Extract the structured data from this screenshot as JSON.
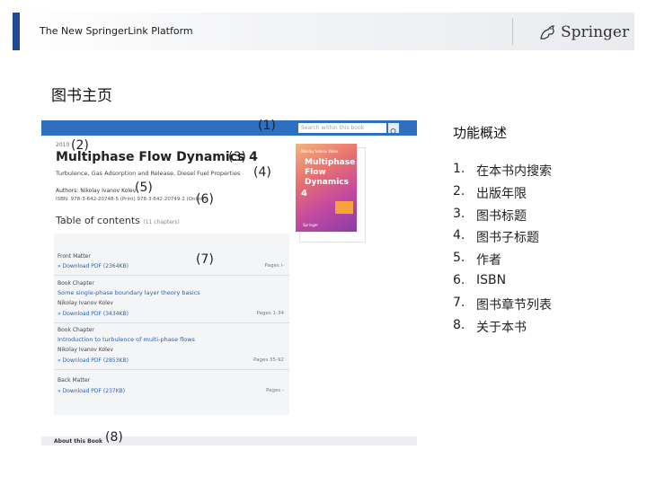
{
  "header": {
    "platform_title": "The New SpringerLink Platform",
    "logo_text": "Springer"
  },
  "page_heading": "图书主页",
  "screenshot": {
    "search_placeholder": "Search within this book",
    "year": "2010",
    "book_title": "Multiphase Flow Dynamics 4",
    "book_subtitle": "Turbulence, Gas Adsorption and Release, Diesel Fuel Properties",
    "authors": "Authors: Nikolay Ivanov Kolev",
    "isbn": "ISBN: 978-3-642-20748-5 (Print) 978-3-642-20749-2 (Online)",
    "toc_heading": "Table of contents",
    "toc_count": "(11 chapters)",
    "sections": [
      {
        "label": "Front Matter",
        "link": "» Download PDF (2364KB)",
        "pages": "Pages i-"
      },
      {
        "label": "Book Chapter",
        "title": "Some single-phase boundary layer theory basics",
        "author": "Nikolay Ivanov Kolev",
        "link": "» Download PDF (3434KB)",
        "pages": "Pages 1-34"
      },
      {
        "label": "Book Chapter",
        "title": "Introduction to turbulence of multi-phase flows",
        "author": "Nikolay Ivanov Kolev",
        "link": "» Download PDF (2853KB)",
        "pages": "Pages 35-92"
      },
      {
        "label": "Back Matter",
        "link": "» Download PDF (237KB)",
        "pages": "Pages -"
      }
    ],
    "cover": {
      "author": "Nikolay Ivanov Kolev",
      "title": "Multiphase Flow Dynamics",
      "number": "4",
      "publisher": "Springer"
    },
    "about_label": "About this Book"
  },
  "callouts": [
    "(1)",
    "(2)",
    "(3)",
    "(4)",
    "(5)",
    "(6)",
    "(7)",
    "(8)"
  ],
  "features": {
    "heading": "功能概述",
    "items": [
      {
        "num": "1.",
        "text": "在本书内搜索"
      },
      {
        "num": "2.",
        "text": "出版年限"
      },
      {
        "num": "3.",
        "text": "图书标题"
      },
      {
        "num": "4.",
        "text": "图书子标题"
      },
      {
        "num": "5.",
        "text": "作者"
      },
      {
        "num": "6.",
        "text": "ISBN"
      },
      {
        "num": "7.",
        "text": "图书章节列表"
      },
      {
        "num": "8.",
        "text": "关于本书"
      }
    ]
  },
  "colors": {
    "accent_bar": "#1f4a99",
    "topbar": "#2f6fbf",
    "link": "#2a62b7"
  }
}
